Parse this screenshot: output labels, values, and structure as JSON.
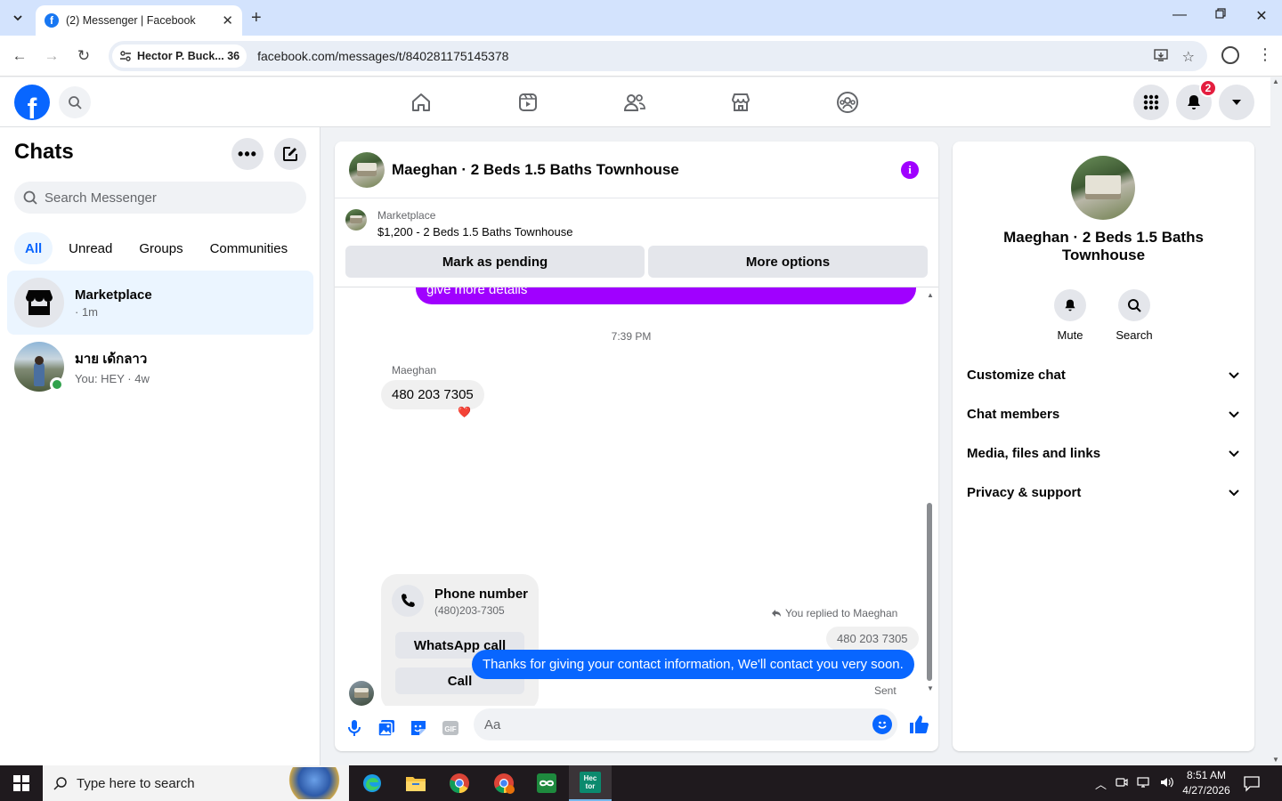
{
  "browser": {
    "tab_title": "(2) Messenger | Facebook",
    "profile_chip": "Hector P. Buck... 36",
    "url": "facebook.com/messages/t/840281175145378"
  },
  "fb": {
    "notification_count": "2",
    "brand_color": "#0866ff"
  },
  "sidebar": {
    "title": "Chats",
    "search_placeholder": "Search Messenger",
    "filters": [
      {
        "label": "All",
        "active": true
      },
      {
        "label": "Unread"
      },
      {
        "label": "Groups"
      },
      {
        "label": "Communities"
      }
    ],
    "chats": [
      {
        "name": "Marketplace",
        "sub": "· 1m",
        "selected": true
      },
      {
        "name": "มาย เด้กลาว",
        "sub": "You: HEY · 4w",
        "online": true
      }
    ]
  },
  "conversation": {
    "title": "Maeghan · 2 Beds 1.5 Baths Townhouse",
    "marketplace_label": "Marketplace",
    "listing": "$1,200 - 2 Beds 1.5 Baths Townhouse",
    "mark_pending": "Mark as pending",
    "more_options": "More options",
    "partial_message": "give more details",
    "timestamp": "7:39 PM",
    "sender_name": "Maeghan",
    "incoming_message": "480 203 7305",
    "reaction": "❤️",
    "contact_card": {
      "title": "Phone number",
      "number": "(480)203-7305",
      "whatsapp_button": "WhatsApp call",
      "call_button": "Call"
    },
    "replied_label": "You replied to Maeghan",
    "quoted_message": "480 203 7305",
    "outgoing_message": "Thanks for giving your contact information, We'll contact you very soon.",
    "status": "Sent",
    "composer_placeholder": "Aa"
  },
  "right_panel": {
    "name": "Maeghan · 2 Beds 1.5 Baths Townhouse",
    "mute_label": "Mute",
    "search_label": "Search",
    "sections": [
      "Customize chat",
      "Chat members",
      "Media, files and links",
      "Privacy & support"
    ]
  },
  "taskbar": {
    "search_placeholder": "Type here to search",
    "time": "8:51 AM",
    "date": "4/27/2026",
    "active_app_label": "Hec tor"
  }
}
